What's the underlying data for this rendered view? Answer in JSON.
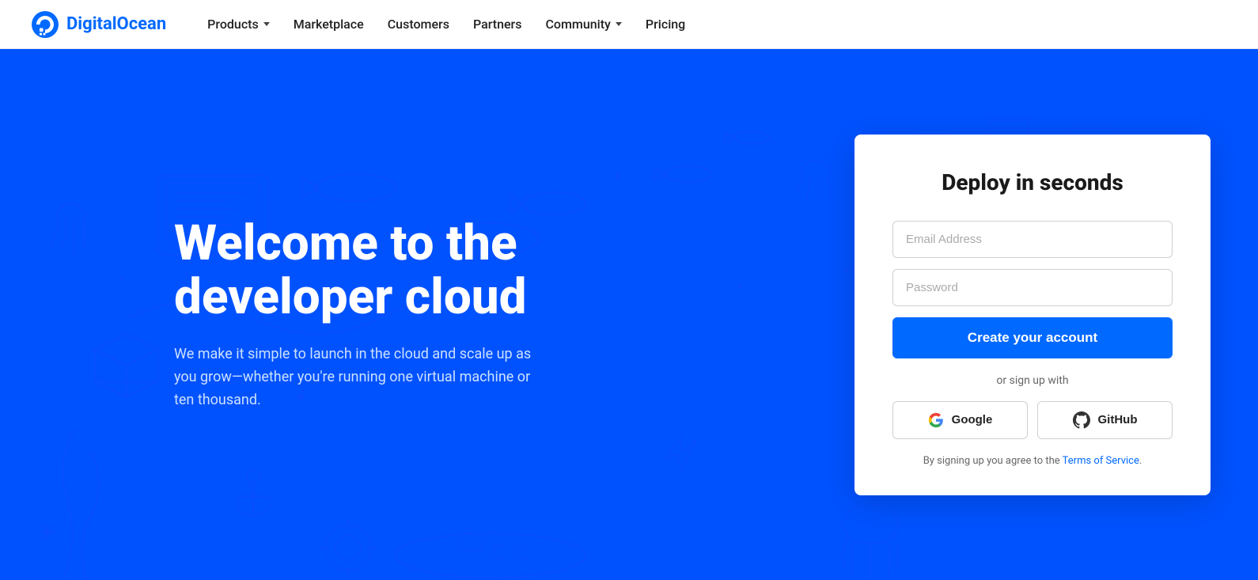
{
  "brand": {
    "name": "DigitalOcean",
    "logo_alt": "DigitalOcean logo"
  },
  "nav": {
    "links": [
      {
        "label": "Products",
        "has_dropdown": true
      },
      {
        "label": "Marketplace",
        "has_dropdown": false
      },
      {
        "label": "Customers",
        "has_dropdown": false
      },
      {
        "label": "Partners",
        "has_dropdown": false
      },
      {
        "label": "Community",
        "has_dropdown": true
      },
      {
        "label": "Pricing",
        "has_dropdown": false
      }
    ]
  },
  "hero": {
    "title": "Welcome to the developer cloud",
    "subtitle": "We make it simple to launch in the cloud and scale up as you grow—whether you're running one virtual machine or ten thousand."
  },
  "signup": {
    "title": "Deploy in seconds",
    "email_placeholder": "Email Address",
    "password_placeholder": "Password",
    "cta_label": "Create your account",
    "or_text": "or sign up with",
    "google_label": "Google",
    "github_label": "GitHub",
    "tos_prefix": "By signing up you agree to the ",
    "tos_link_text": "Terms of Service",
    "tos_suffix": "."
  }
}
